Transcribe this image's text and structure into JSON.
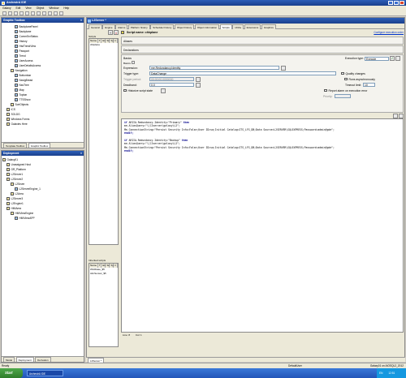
{
  "app": {
    "title": "ArchestrA IDE"
  },
  "menu": [
    "Galaxy",
    "Edit",
    "View",
    "Object",
    "Window",
    "Help"
  ],
  "toolbox": {
    "title": "Graphic Toolbox",
    "items": [
      {
        "label": "BackplanePanel",
        "level": 3
      },
      {
        "label": "Backplane",
        "level": 3
      },
      {
        "label": "CommSrvStatus",
        "level": 3
      },
      {
        "label": "History",
        "level": 3
      },
      {
        "label": "HistTrendView",
        "level": 3
      },
      {
        "label": "Passport",
        "level": 3
      },
      {
        "label": "Trend",
        "level": 3
      },
      {
        "label": "UserAccess",
        "level": 3
      },
      {
        "label": "UserDetailsAccess",
        "level": 3
      },
      {
        "label": "Navigation",
        "level": 2
      },
      {
        "label": "Bottombar",
        "level": 3
      },
      {
        "label": "NavigBread",
        "level": 3
      },
      {
        "label": "NavTree",
        "level": 3
      },
      {
        "label": "Map",
        "level": 3
      },
      {
        "label": "Topbar",
        "level": 3
      },
      {
        "label": "TTSShow",
        "level": 3
      },
      {
        "label": "SortObjects",
        "level": 2
      },
      {
        "label": "ICS",
        "level": 1
      },
      {
        "label": "SOLDG",
        "level": 1
      },
      {
        "label": "Windows Forms",
        "level": 1
      },
      {
        "label": "Galaxies Here",
        "level": 1
      }
    ],
    "tabs": [
      "Template Toolbox",
      "Graphic Toolbox"
    ]
  },
  "deployment": {
    "title": "Deployment",
    "items": [
      {
        "label": "Galaxy01",
        "level": 0
      },
      {
        "label": "Unassigned Host",
        "level": 1
      },
      {
        "label": "GR_Platform",
        "level": 1
      },
      {
        "label": "L2Server1",
        "level": 1
      },
      {
        "label": "L2Server2",
        "level": 1
      },
      {
        "label": "L2Sever",
        "level": 2
      },
      {
        "label": "L2ServerEngine_1",
        "level": 3
      },
      {
        "label": "L2Area",
        "level": 2
      },
      {
        "label": "L2Server3",
        "level": 1
      },
      {
        "label": "L2Engine1",
        "level": 1
      },
      {
        "label": "HMIArea",
        "level": 1
      },
      {
        "label": "HMIViewEngine",
        "level": 2
      },
      {
        "label": "HMIViewAPP",
        "level": 3
      }
    ],
    "tabs": [
      "Model",
      "Deployment",
      "Derivation"
    ]
  },
  "editor": {
    "title": "L2Server *",
    "doc_tab": "L2Server *",
    "tabs": [
      "General",
      "Engine",
      "Alarms",
      "Platform history",
      "Scheduler history",
      "Object history",
      "Object information",
      "Scripts",
      "UDAs",
      "Extensions",
      "Graphics"
    ],
    "active_tab": "Scripts",
    "scripts_label": "Scripts",
    "scripts_columns": [
      "Name",
      "T",
      "Ex",
      "Sc",
      "Sy",
      "Ir"
    ],
    "scripts_rows": [
      [
        "chkplane"
      ]
    ],
    "inherited_label": "Inherited scripts",
    "inherited_rows": [
      [
        "Wtrdbase_$5"
      ],
      [
        "AlmSensor_$5"
      ]
    ],
    "script_name_label": "Script name:",
    "script_name": "chkplane",
    "config_link": "Configure execution order",
    "aliases_label": "Aliases",
    "declarations_label": "Declarations",
    "basics_label": "Basics",
    "execution_type_label": "Execution type:",
    "execution_type": "Execute",
    "expression_label": "Expression:",
    "expression_value": "me.Redundancy.Identity",
    "trigger_type_label": "Trigger type:",
    "trigger_type": "DataChange",
    "quality_changes_label": "Quality changes",
    "trigger_period_label": "Trigger period:",
    "trigger_period": "00:00:00.0000000",
    "run_async_label": "Runs asynchronously",
    "deadband_label": "Deadband:",
    "deadband": "0.0",
    "timeout_label": "Timeout limit:",
    "timeout_value": "10",
    "historize_label": "Historize script state",
    "alarm_label": "Report alarm on execution error",
    "severity_label": "Priority:",
    "severity_value": "",
    "code_lines": [
      [
        {
          "t": "kw",
          "v": "if "
        },
        {
          "t": "n",
          "v": "ARIIA.Redundancy.Identity=\"Primary\" "
        },
        {
          "t": "kw",
          "v": "then"
        }
      ],
      [
        {
          "t": "n",
          "v": "me.AliasQuery=\"\\\\l2server\\galaxy\\L2\";"
        }
      ],
      [
        {
          "t": "n",
          "v": "Me.ConnectionString=\"Persist Security Info=False;User ID=sa;Initial Catalog=ITS_LFS_DB;Data Source=L2SERVER\\SQLEXPRESS;Password=admin@gde\";"
        }
      ],
      [
        {
          "t": "kw",
          "v": "endif;"
        }
      ],
      [
        {
          "t": "n",
          "v": ""
        }
      ],
      [
        {
          "t": "kw",
          "v": "if "
        },
        {
          "t": "n",
          "v": "ARIIA.Redundancy.Identity=\"Backup\" "
        },
        {
          "t": "kw",
          "v": "then"
        }
      ],
      [
        {
          "t": "n",
          "v": "me.AliasQuery=\"\\\\l2server\\galaxy\\L2\";"
        }
      ],
      [
        {
          "t": "n",
          "v": "Me.ConnectionString=\"Persist Security Info=False;User ID=sa;Initial Catalog=ITS_LFS_DB;Data Source=L2SERVER\\SQLEXPRESS;Password=admin@gde\";"
        }
      ],
      [
        {
          "t": "kw",
          "v": "endif;"
        }
      ]
    ],
    "status_line": "Line: 8",
    "status_col": "Col: 1"
  },
  "statusbar": {
    "left": "Ready",
    "user": "DefaultUser",
    "right": "Galaxy01 on AIOSQL2_2012"
  },
  "taskbar": {
    "start": "Start",
    "items": [
      "ArchestrA IDE"
    ],
    "lang": "EN",
    "clock": "12:51"
  }
}
